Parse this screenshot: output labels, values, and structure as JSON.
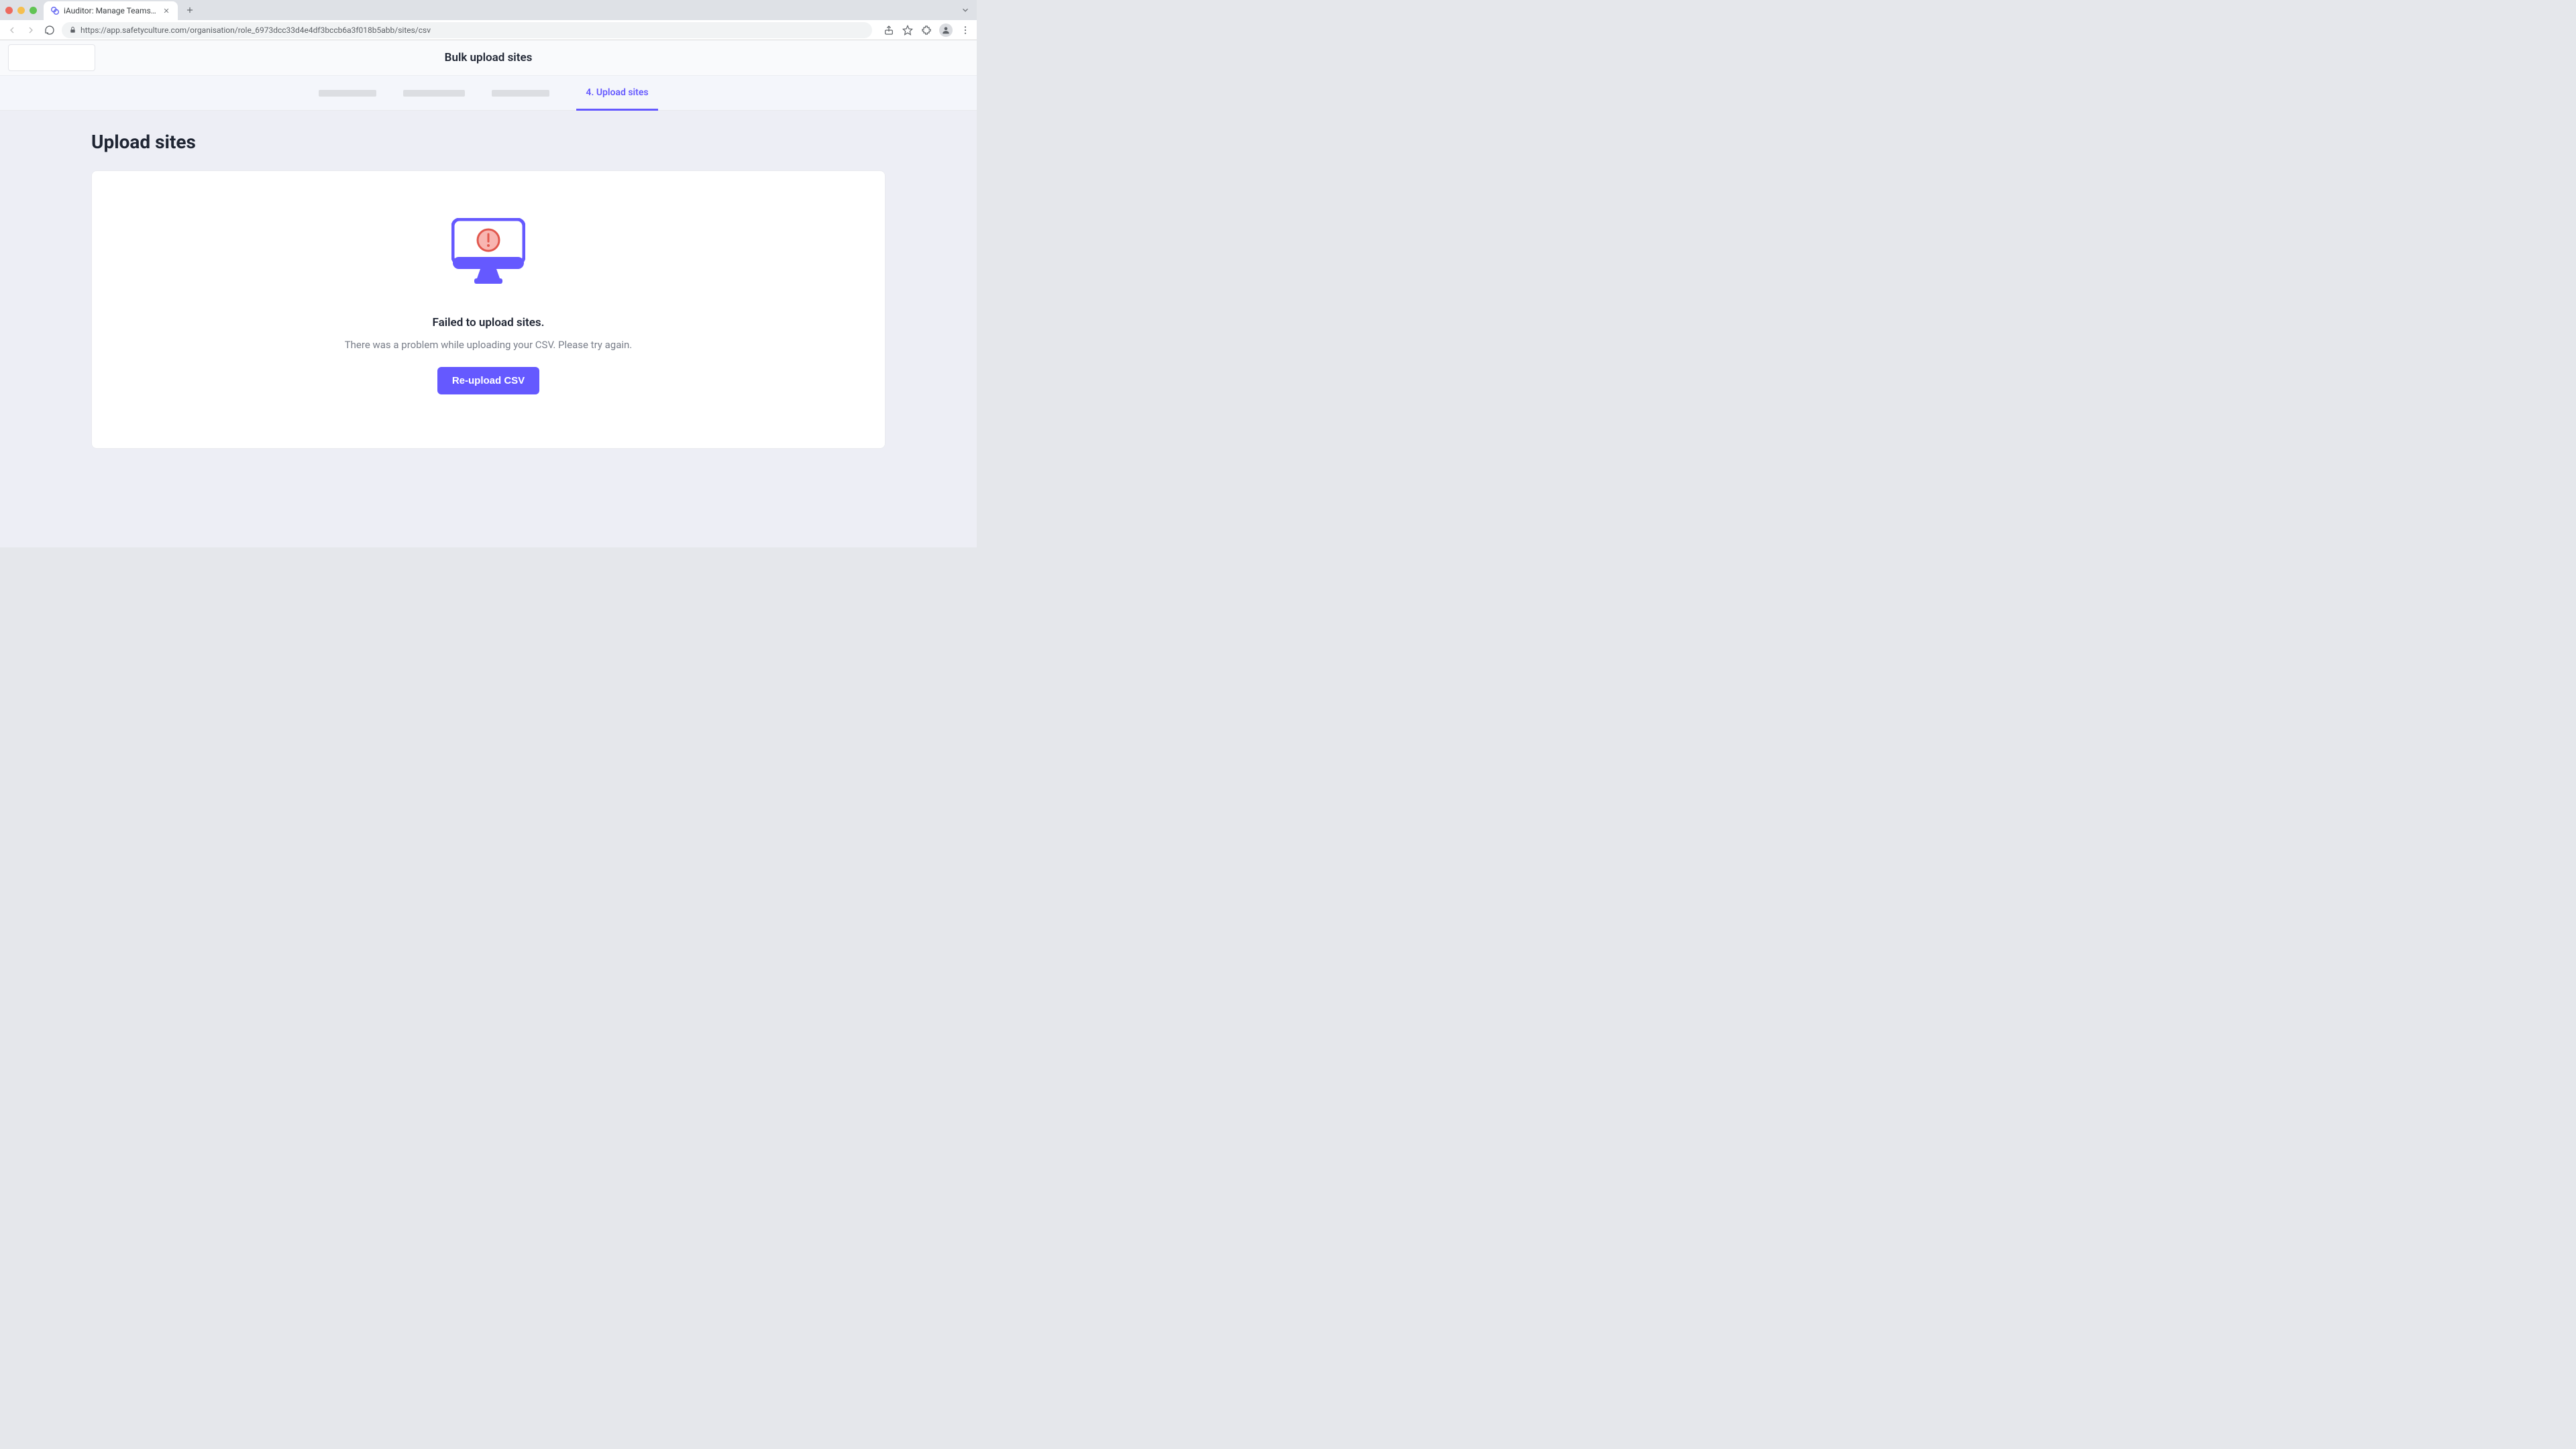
{
  "browser": {
    "tab_title": "iAuditor: Manage Teams and In",
    "url": "https://app.safetyculture.com/organisation/role_6973dcc33d4e4df3bccb6a3f018b5abb/sites/csv"
  },
  "header": {
    "title": "Bulk upload sites"
  },
  "steps": {
    "active_label": "4. Upload sites"
  },
  "main": {
    "heading": "Upload sites",
    "error_title": "Failed to upload sites.",
    "error_subtitle": "There was a problem while uploading your CSV. Please try again.",
    "retry_button": "Re-upload CSV"
  },
  "colors": {
    "accent": "#6559ff",
    "error_circle": "#f8a9a9",
    "error_ring": "#e1574d"
  }
}
